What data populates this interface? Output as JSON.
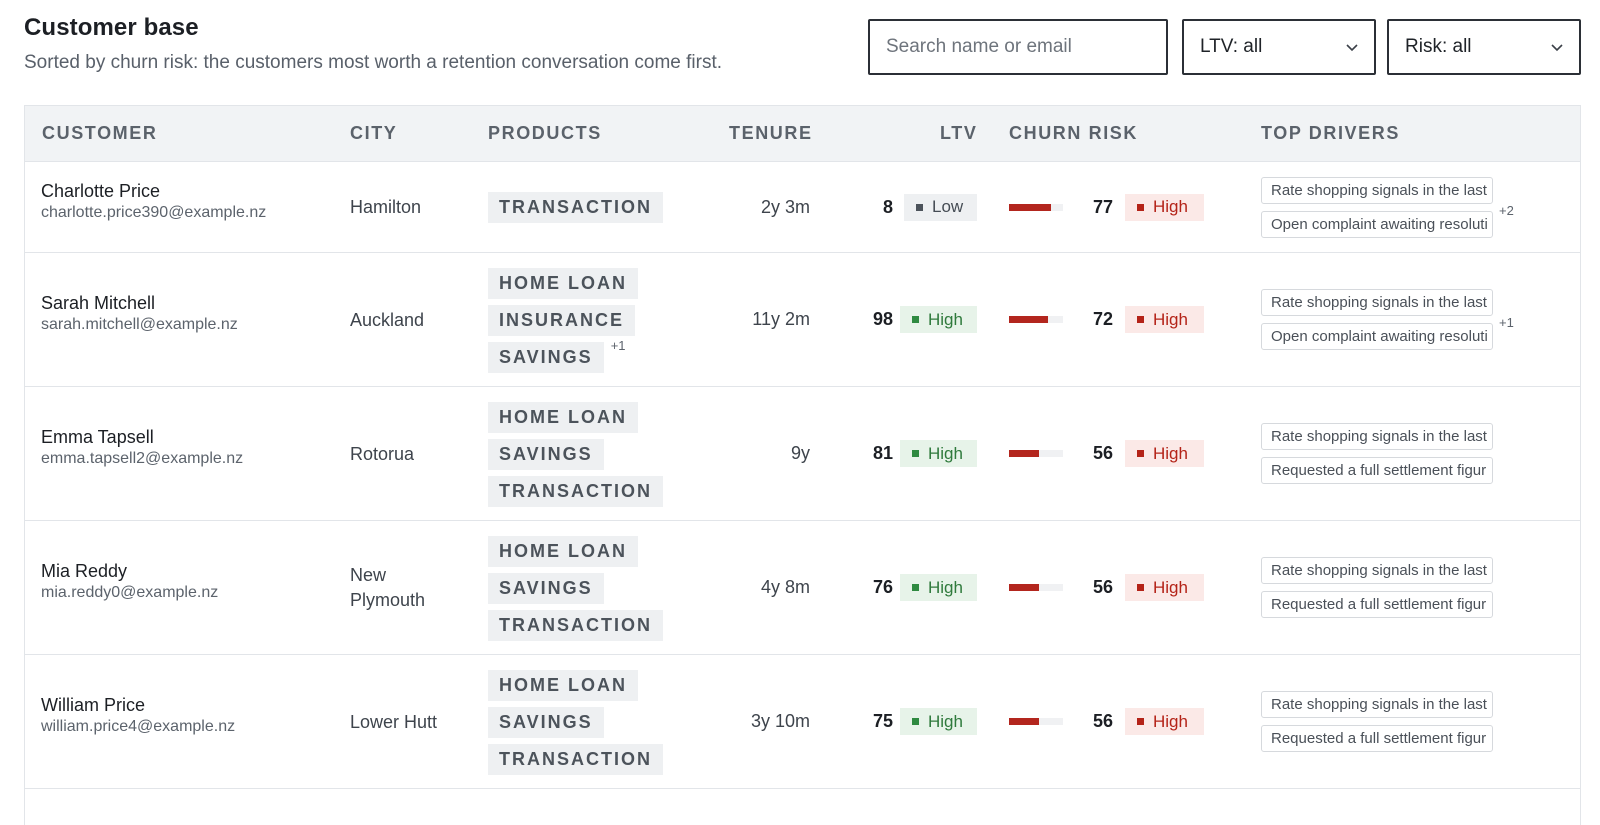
{
  "page": {
    "title": "Customer base",
    "subtitle": "Sorted by churn risk: the customers most worth a retention conversation come first."
  },
  "filters": {
    "search_placeholder": "Search name or email",
    "ltv_select": "LTV: all",
    "risk_select": "Risk: all"
  },
  "table": {
    "columns": [
      "CUSTOMER",
      "CITY",
      "PRODUCTS",
      "TENURE",
      "LTV",
      "CHURN RISK",
      "TOP DRIVERS"
    ],
    "rows": [
      {
        "name": "Charlotte Price",
        "email": "charlotte.price390@example.nz",
        "city": "Hamilton",
        "products": [
          "TRANSACTION"
        ],
        "products_more": "",
        "tenure": "2y 3m",
        "ltv_value": "8",
        "ltv_level": "Low",
        "risk_value": "77",
        "risk_fraction": 0.77,
        "risk_level": "High",
        "drivers": [
          "Rate shopping signals in the last",
          "Open complaint awaiting resoluti"
        ],
        "drivers_more": "+2"
      },
      {
        "name": "Sarah Mitchell",
        "email": "sarah.mitchell@example.nz",
        "city": "Auckland",
        "products": [
          "HOME LOAN",
          "INSURANCE",
          "SAVINGS"
        ],
        "products_more": "+1",
        "tenure": "11y 2m",
        "ltv_value": "98",
        "ltv_level": "High",
        "risk_value": "72",
        "risk_fraction": 0.72,
        "risk_level": "High",
        "drivers": [
          "Rate shopping signals in the last",
          "Open complaint awaiting resoluti"
        ],
        "drivers_more": "+1"
      },
      {
        "name": "Emma Tapsell",
        "email": "emma.tapsell2@example.nz",
        "city": "Rotorua",
        "products": [
          "HOME LOAN",
          "SAVINGS",
          "TRANSACTION"
        ],
        "products_more": "",
        "tenure": "9y",
        "ltv_value": "81",
        "ltv_level": "High",
        "risk_value": "56",
        "risk_fraction": 0.56,
        "risk_level": "High",
        "drivers": [
          "Rate shopping signals in the last",
          "Requested a full settlement figur"
        ],
        "drivers_more": ""
      },
      {
        "name": "Mia Reddy",
        "email": "mia.reddy0@example.nz",
        "city": "New Plymouth",
        "products": [
          "HOME LOAN",
          "SAVINGS",
          "TRANSACTION"
        ],
        "products_more": "",
        "tenure": "4y 8m",
        "ltv_value": "76",
        "ltv_level": "High",
        "risk_value": "56",
        "risk_fraction": 0.56,
        "risk_level": "High",
        "drivers": [
          "Rate shopping signals in the last",
          "Requested a full settlement figur"
        ],
        "drivers_more": ""
      },
      {
        "name": "William Price",
        "email": "william.price4@example.nz",
        "city": "Lower Hutt",
        "products": [
          "HOME LOAN",
          "SAVINGS",
          "TRANSACTION"
        ],
        "products_more": "",
        "tenure": "3y 10m",
        "ltv_value": "75",
        "ltv_level": "High",
        "risk_value": "56",
        "risk_fraction": 0.56,
        "risk_level": "High",
        "drivers": [
          "Rate shopping signals in the last",
          "Requested a full settlement figur"
        ],
        "drivers_more": ""
      }
    ]
  }
}
